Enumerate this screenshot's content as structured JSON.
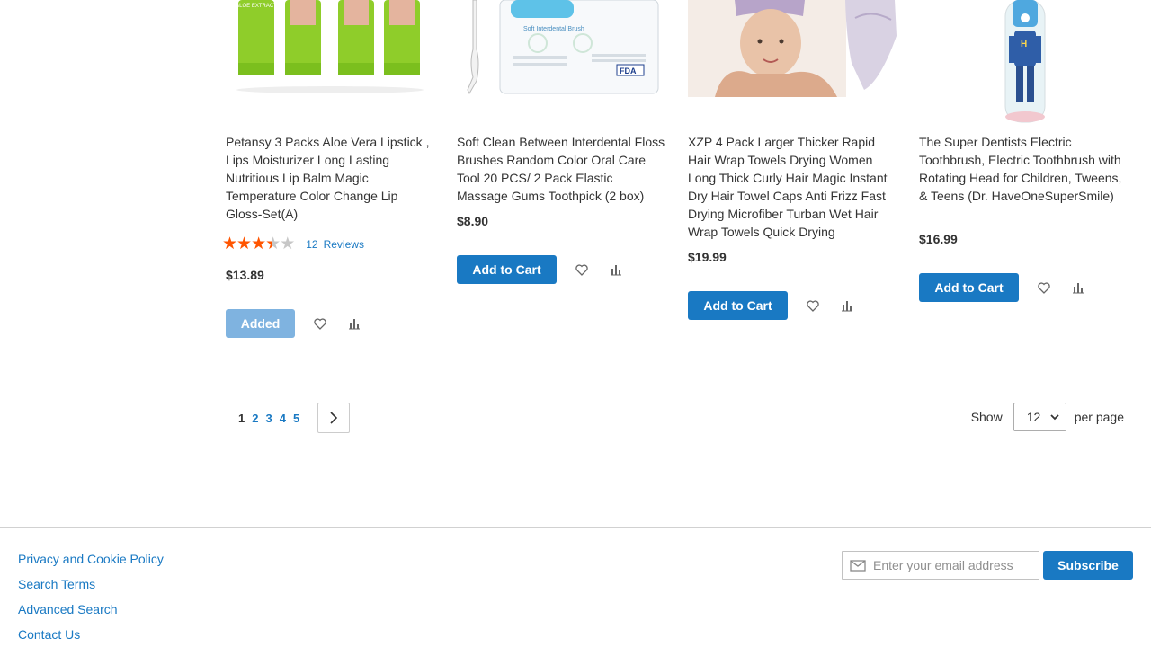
{
  "products": [
    {
      "name": "Petansy 3 Packs Aloe Vera Lipstick , Lips Moisturizer Long Lasting Nutritious Lip Balm Magic Temperature Color Change Lip Gloss-Set(A)",
      "image_label": "ALOE EXTRACT",
      "rating_percent": 70,
      "review_count": "12",
      "review_label": "Reviews",
      "price": "$13.89",
      "button_label": "Added"
    },
    {
      "name": "Soft Clean Between Interdental Floss Brushes Random Color Oral Care Tool 20 PCS/ 2 Pack Elastic Massage Gums Toothpick (2 box)",
      "image_label": "Soft Interdental Brush",
      "price": "$8.90",
      "button_label": "Add to Cart"
    },
    {
      "name": "XZP 4 Pack Larger Thicker Rapid Hair Wrap Towels Drying Women Long Thick Curly Hair Magic Instant Dry Hair Towel Caps Anti Frizz Fast Drying Microfiber Turban Wet Hair Wrap Towels Quick Drying",
      "price": "$19.99",
      "button_label": "Add to Cart"
    },
    {
      "name": "The Super Dentists Electric Toothbrush, Electric Toothbrush with Rotating Head for Children, Tweens, & Teens (Dr. HaveOneSuperSmile)",
      "price": "$16.99",
      "button_label": "Add to Cart"
    }
  ],
  "pager": {
    "pages": [
      "1",
      "2",
      "3",
      "4",
      "5"
    ],
    "current": "1"
  },
  "limiter": {
    "show_label": "Show",
    "value": "12",
    "per_page_label": "per page"
  },
  "footer": {
    "links": [
      "Privacy and Cookie Policy",
      "Search Terms",
      "Advanced Search",
      "Contact Us"
    ],
    "newsletter_placeholder": "Enter your email address",
    "subscribe_label": "Subscribe"
  },
  "colors": {
    "accent": "#1979c3",
    "added_button": "#7fb3e0",
    "star": "#ff5501"
  }
}
